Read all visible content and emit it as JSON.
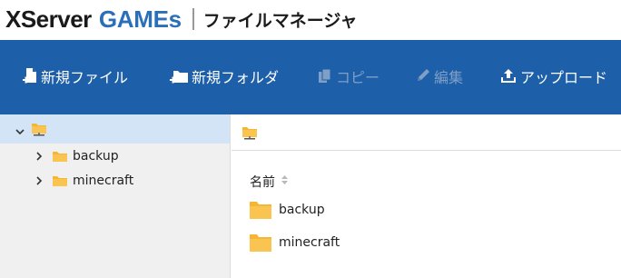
{
  "header": {
    "logo_x": "X",
    "logo_server": "Server",
    "logo_games": "GAMEs",
    "title": "ファイルマネージャ"
  },
  "toolbar": {
    "new_file": "新規ファイル",
    "new_folder": "新規フォルダ",
    "copy": "コピー",
    "edit": "編集",
    "upload": "アップロード"
  },
  "tree": {
    "items": [
      {
        "label": "backup"
      },
      {
        "label": "minecraft"
      }
    ]
  },
  "list": {
    "column_name": "名前",
    "rows": [
      {
        "name": "backup"
      },
      {
        "name": "minecraft"
      }
    ]
  },
  "colors": {
    "toolbar_bg": "#1d5fa8",
    "brand_blue": "#2a6fb8",
    "folder": "#f6b632",
    "selected_row": "#d4e4f7"
  }
}
